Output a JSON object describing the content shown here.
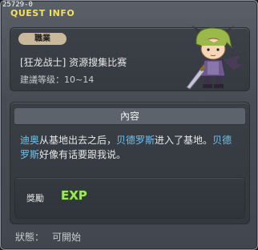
{
  "window": {
    "quest_id": "25729-0",
    "title": "QUEST INFO"
  },
  "quest": {
    "job_badge": "職業",
    "name": "[狂龙战士] 资源搜集比赛",
    "level": "建議等级：10~14"
  },
  "content": {
    "header": "內容",
    "description": [
      {
        "text": "迪奥",
        "highlight": true
      },
      {
        "text": "从基地出去之后，",
        "highlight": false
      },
      {
        "text": "贝德罗斯",
        "highlight": true
      },
      {
        "text": "进入了基地。",
        "highlight": false
      },
      {
        "text": "贝德罗斯",
        "highlight": true
      },
      {
        "text": "好像有话要跟我说。",
        "highlight": false
      }
    ]
  },
  "reward": {
    "label": "獎勵",
    "icon": "exp-icon",
    "icon_text": "EXP"
  },
  "status": {
    "label": "狀態：",
    "value": "可開始"
  },
  "colors": {
    "title": "#f5e15a",
    "highlight": "#6ec3f0",
    "exp_green": "#9ee65a"
  }
}
